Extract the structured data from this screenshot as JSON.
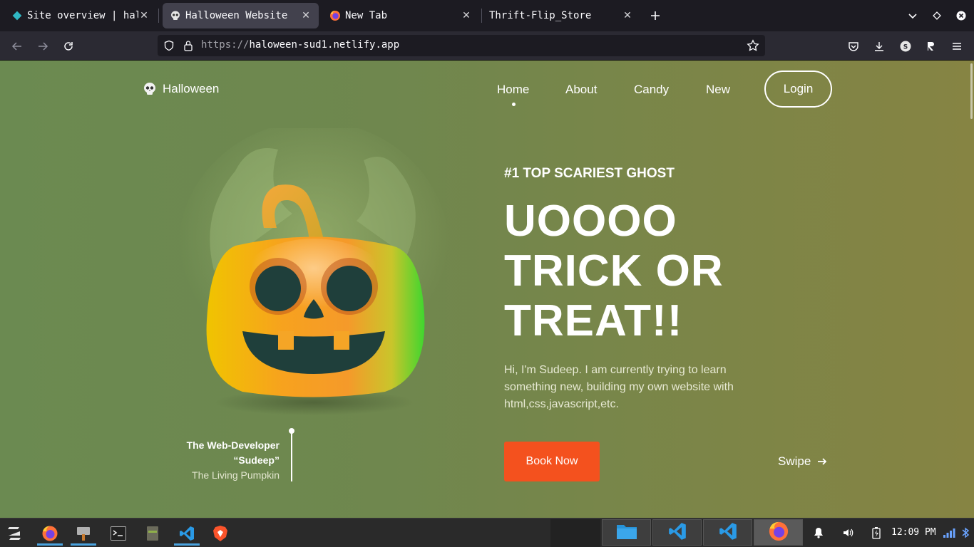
{
  "browser": {
    "tabs": [
      {
        "title": "Site overview | halow",
        "active": false,
        "favicon": "netlify-icon"
      },
      {
        "title": "Halloween Website",
        "active": true,
        "favicon": "skull-icon"
      },
      {
        "title": "New Tab",
        "active": false,
        "favicon": "firefox-icon"
      },
      {
        "title": "Thrift-Flip_Store",
        "active": false,
        "favicon": ""
      }
    ],
    "url_scheme": "https://",
    "url_host": "haloween-sud1.netlify.app"
  },
  "site": {
    "logo": "Halloween",
    "nav": [
      "Home",
      "About",
      "Candy",
      "New"
    ],
    "active_nav": "Home",
    "login": "Login",
    "kicker": "#1 TOP SCARIEST GHOST",
    "headline": [
      "UOOOO",
      "TRICK OR",
      "TREAT!!"
    ],
    "description": "Hi, I'm Sudeep. I am currently trying to learn something new, building my own website with html,css,javascript,etc.",
    "book_button": "Book Now",
    "swipe": "Swipe",
    "credit": {
      "line1": "The Web-Developer",
      "line2": "“Sudeep”",
      "line3": "The Living Pumpkin"
    }
  },
  "taskbar": {
    "pinned": [
      "zorin-menu-icon",
      "firefox-icon",
      "paint-icon",
      "terminal-icon",
      "file-roller-icon",
      "vscode-icon",
      "brave-icon"
    ],
    "windows": [
      "files-icon",
      "vscode-icon",
      "vscode-icon",
      "firefox-icon"
    ],
    "clock": "12:09 PM"
  },
  "colors": {
    "accent": "#f4511e",
    "page_bg_left": "#6b8a51",
    "page_bg_right": "#868443"
  }
}
